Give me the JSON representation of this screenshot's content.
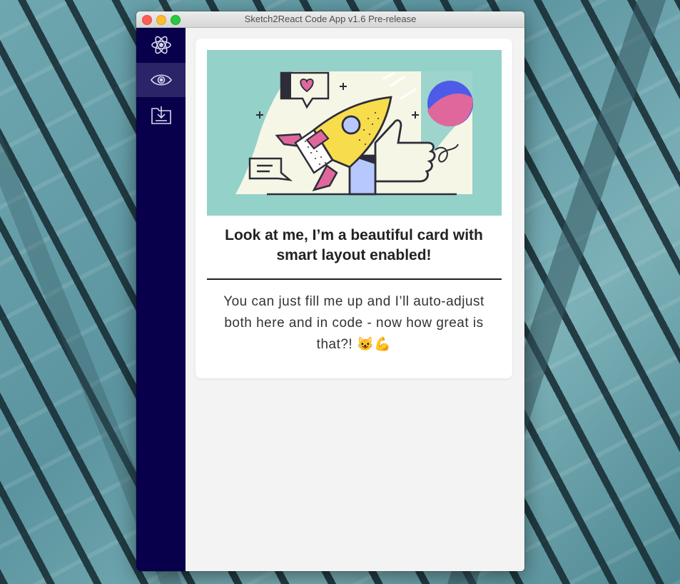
{
  "window": {
    "title": "Sketch2React Code App v1.6 Pre-release"
  },
  "sidebar": {
    "items": [
      {
        "icon": "react-atom-icon",
        "active": false
      },
      {
        "icon": "eye-icon",
        "active": true
      },
      {
        "icon": "export-icon",
        "active": false
      }
    ]
  },
  "card": {
    "title": "Look at me, I’m a beautiful card with smart layout enabled!",
    "body": "You can just fill me up and I’ll auto-adjust both here and in code - now how great is that?! 😺💪"
  },
  "colors": {
    "sidebar": "#08004a",
    "sidebar_active": "#2b2468",
    "image_bg": "#94d2c9",
    "rocket_yellow": "#f7dd4b",
    "accent_pink": "#e0679c",
    "accent_blue": "#4d5be8"
  }
}
